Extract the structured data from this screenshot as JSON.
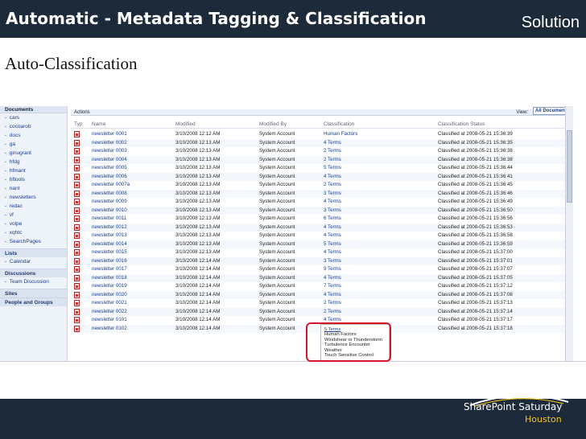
{
  "slide": {
    "title": "Automatic - Metadata Tagging & Classification",
    "tag": "Solution",
    "subtitle": "Auto-Classification"
  },
  "sharepoint": {
    "toolbar": {
      "actions": "Actions",
      "view_label": "View:",
      "view_value": "All Documents"
    },
    "quick_launch": {
      "top_header": "Documents",
      "items": [
        "cars",
        "cocoarob",
        "docs",
        "ga",
        "ginugrant",
        "hfdg",
        "hfmant",
        "hftools",
        "nant",
        "newsletters",
        "redac",
        "vf",
        "volpe",
        "xqhtc",
        "SearchPages"
      ],
      "lists_header": "Lists",
      "lists_items": [
        "Calendar"
      ],
      "discussions_header": "Discussions",
      "discussions_items": [
        "Team Discussion"
      ],
      "sites_header": "Sites",
      "people_header": "People and Groups"
    },
    "columns": {
      "type": "Type",
      "name": "Name",
      "modified": "Modified",
      "modified_by": "Modified By",
      "classification": "Classification",
      "status": "Classification Status"
    },
    "rows": [
      {
        "name": "newsletter 0001",
        "modified": "3/10/2008 12:12 AM",
        "by": "System Account",
        "classification": "Human Factors",
        "status": "Classified at 2008-05-21 15:36:39"
      },
      {
        "name": "newsletter 0002",
        "modified": "3/10/2008 12:13 AM",
        "by": "System Account",
        "classification": "4 Terms",
        "status": "Classified at 2008-05-21 15:36:35"
      },
      {
        "name": "newsletter 0003",
        "modified": "3/10/2008 12:13 AM",
        "by": "System Account",
        "classification": "2 Terms",
        "status": "Classified at 2008-05-21 15:36:38"
      },
      {
        "name": "newsletter 0004",
        "modified": "3/10/2008 12:13 AM",
        "by": "System Account",
        "classification": "2 Terms",
        "status": "Classified at 2008-05-21 15:36:38"
      },
      {
        "name": "newsletter 0005",
        "modified": "3/10/2008 12:13 AM",
        "by": "System Account",
        "classification": "5 Terms",
        "status": "Classified at 2008-05-21 15:36:44"
      },
      {
        "name": "newsletter 0006",
        "modified": "3/10/2008 12:13 AM",
        "by": "System Account",
        "classification": "4 Terms",
        "status": "Classified at 2008-05-21 15:36:41"
      },
      {
        "name": "newsletter 0007a",
        "modified": "3/10/2008 12:13 AM",
        "by": "System Account",
        "classification": "2 Terms",
        "status": "Classified at 2008-05-21 15:36:45"
      },
      {
        "name": "newsletter 0008",
        "modified": "3/10/2008 12:13 AM",
        "by": "System Account",
        "classification": "3 Terms",
        "status": "Classified at 2008-05-21 15:36:46"
      },
      {
        "name": "newsletter 0009",
        "modified": "3/10/2008 12:13 AM",
        "by": "System Account",
        "classification": "4 Terms",
        "status": "Classified at 2008-05-21 15:36:49"
      },
      {
        "name": "newsletter 0010",
        "modified": "3/10/2008 12:13 AM",
        "by": "System Account",
        "classification": "3 Terms",
        "status": "Classified at 2008-05-21 15:36:50"
      },
      {
        "name": "newsletter 0011",
        "modified": "3/10/2008 12:13 AM",
        "by": "System Account",
        "classification": "6 Terms",
        "status": "Classified at 2008-05-21 15:36:56"
      },
      {
        "name": "newsletter 0012",
        "modified": "3/10/2008 12:13 AM",
        "by": "System Account",
        "classification": "4 Terms",
        "status": "Classified at 2008-05-21 15:36:53"
      },
      {
        "name": "newsletter 0013",
        "modified": "3/10/2008 12:13 AM",
        "by": "System Account",
        "classification": "4 Terms",
        "status": "Classified at 2008-05-21 15:36:58"
      },
      {
        "name": "newsletter 0014",
        "modified": "3/10/2008 12:13 AM",
        "by": "System Account",
        "classification": "5 Terms",
        "status": "Classified at 2008-05-21 15:36:59"
      },
      {
        "name": "newsletter 0015",
        "modified": "3/10/2008 12:13 AM",
        "by": "System Account",
        "classification": "4 Terms",
        "status": "Classified at 2008-05-21 15:37:00"
      },
      {
        "name": "newsletter 0016",
        "modified": "3/10/2008 12:14 AM",
        "by": "System Account",
        "classification": "3 Terms",
        "status": "Classified at 2008-05-21 15:37:01"
      },
      {
        "name": "newsletter 0017",
        "modified": "3/10/2008 12:14 AM",
        "by": "System Account",
        "classification": "9 Terms",
        "status": "Classified at 2008-05-21 15:37:07"
      },
      {
        "name": "newsletter 0018",
        "modified": "3/10/2008 12:14 AM",
        "by": "System Account",
        "classification": "4 Terms",
        "status": "Classified at 2008-05-21 15:37:05"
      },
      {
        "name": "newsletter 0019",
        "modified": "3/10/2008 12:14 AM",
        "by": "System Account",
        "classification": "7 Terms",
        "status": "Classified at 2008-05-21 15:37:12"
      },
      {
        "name": "newsletter 0020",
        "modified": "3/10/2008 12:14 AM",
        "by": "System Account",
        "classification": "4 Terms",
        "status": "Classified at 2008-05-21 15:37:08"
      },
      {
        "name": "newsletter 0021",
        "modified": "3/10/2008 12:14 AM",
        "by": "System Account",
        "classification": "2 Terms",
        "status": "Classified at 2008-05-21 15:37:13"
      },
      {
        "name": "newsletter 0022",
        "modified": "3/10/2008 12:14 AM",
        "by": "System Account",
        "classification": "2 Terms",
        "status": "Classified at 2008-05-21 15:37:14"
      },
      {
        "name": "newsletter 0101",
        "modified": "3/10/2008 12:14 AM",
        "by": "System Account",
        "classification": "4 Terms",
        "status": "Classified at 2008-05-21 15:37:17"
      },
      {
        "name": "newsletter 0102",
        "modified": "3/10/2008 12:14 AM",
        "by": "System Account",
        "classification": "",
        "status": "Classified at 2008-05-21 15:37:18"
      }
    ],
    "popup_terms": [
      "5 Terms",
      "Human Factors",
      "Windshear or Thunderstorm",
      "Turbulence Encounter",
      "Weather",
      "Touch Sensitive Control"
    ]
  },
  "brand": {
    "main": "SharePoint Saturday",
    "sub": "Houston"
  },
  "colors": {
    "title_bar": "#1d2a3a",
    "highlight": "#d3182a",
    "brand_accent": "#f0c419"
  }
}
